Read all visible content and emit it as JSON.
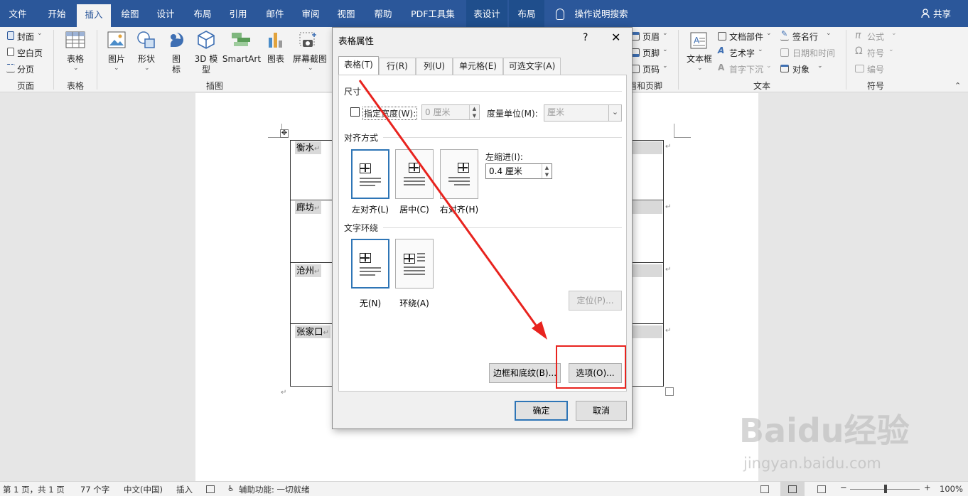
{
  "ribbon_tabs": [
    "文件",
    "开始",
    "插入",
    "绘图",
    "设计",
    "布局",
    "引用",
    "邮件",
    "审阅",
    "视图",
    "帮助",
    "PDF工具集",
    "表设计",
    "布局"
  ],
  "active_tab": "插入",
  "tell_me": "操作说明搜索",
  "share": "共享",
  "ribbon": {
    "pages": {
      "cover": "封面",
      "blank": "空白页",
      "break": "分页",
      "label": "页面"
    },
    "table": {
      "btn": "表格",
      "label": "表格"
    },
    "illus": {
      "picture": "图片",
      "shapes": "形状",
      "icons": "图\n标",
      "model": "3D 模\n型",
      "smartart": "SmartArt",
      "chart": "图表",
      "screenshot": "屏幕截图",
      "label": "插图"
    },
    "hf": {
      "header": "页眉",
      "footer": "页脚",
      "pagenum": "页码",
      "label": "页眉和页脚"
    },
    "text": {
      "textbox": "文本框",
      "parts": "文档部件",
      "wordart": "艺术字",
      "dropcap": "首字下沉",
      "sigline": "签名行",
      "datetime": "日期和时间",
      "object": "对象",
      "label": "文本"
    },
    "symbols": {
      "equation": "公式",
      "symbol": "符号",
      "number": "编号",
      "label": "符号"
    }
  },
  "doc_rows": [
    "衡水",
    "廊坊",
    "沧州",
    "张家口"
  ],
  "dialog": {
    "title": "表格属性",
    "help": "?",
    "close": "✕",
    "tabs": [
      "表格(T)",
      "行(R)",
      "列(U)",
      "单元格(E)",
      "可选文字(A)"
    ],
    "size_label": "尺寸",
    "pref_width": "指定宽度(W):",
    "width_value": "0 厘米",
    "measure_label": "度量单位(M):",
    "measure_value": "厘米",
    "align_label": "对齐方式",
    "align_left": "左对齐(L)",
    "align_center": "居中(C)",
    "align_right": "右对齐(H)",
    "indent_label": "左缩进(I):",
    "indent_value": "0.4 厘米",
    "wrap_label": "文字环绕",
    "wrap_none": "无(N)",
    "wrap_around": "环绕(A)",
    "position_btn": "定位(P)...",
    "borders_btn": "边框和底纹(B)...",
    "options_btn": "选项(O)...",
    "ok": "确定",
    "cancel": "取消"
  },
  "status": {
    "page": "第 1 页，共 1 页",
    "words": "77 个字",
    "lang": "中文(中国)",
    "mode": "插入",
    "access": "辅助功能: 一切就绪",
    "zoom": "100%"
  },
  "watermark": {
    "brand": "Baidu经验",
    "url": "jingyan.baidu.com"
  },
  "colors": {
    "ribbon_blue": "#2b579a",
    "annotation_red": "#e8231e",
    "select_blue": "#2e75b6"
  }
}
